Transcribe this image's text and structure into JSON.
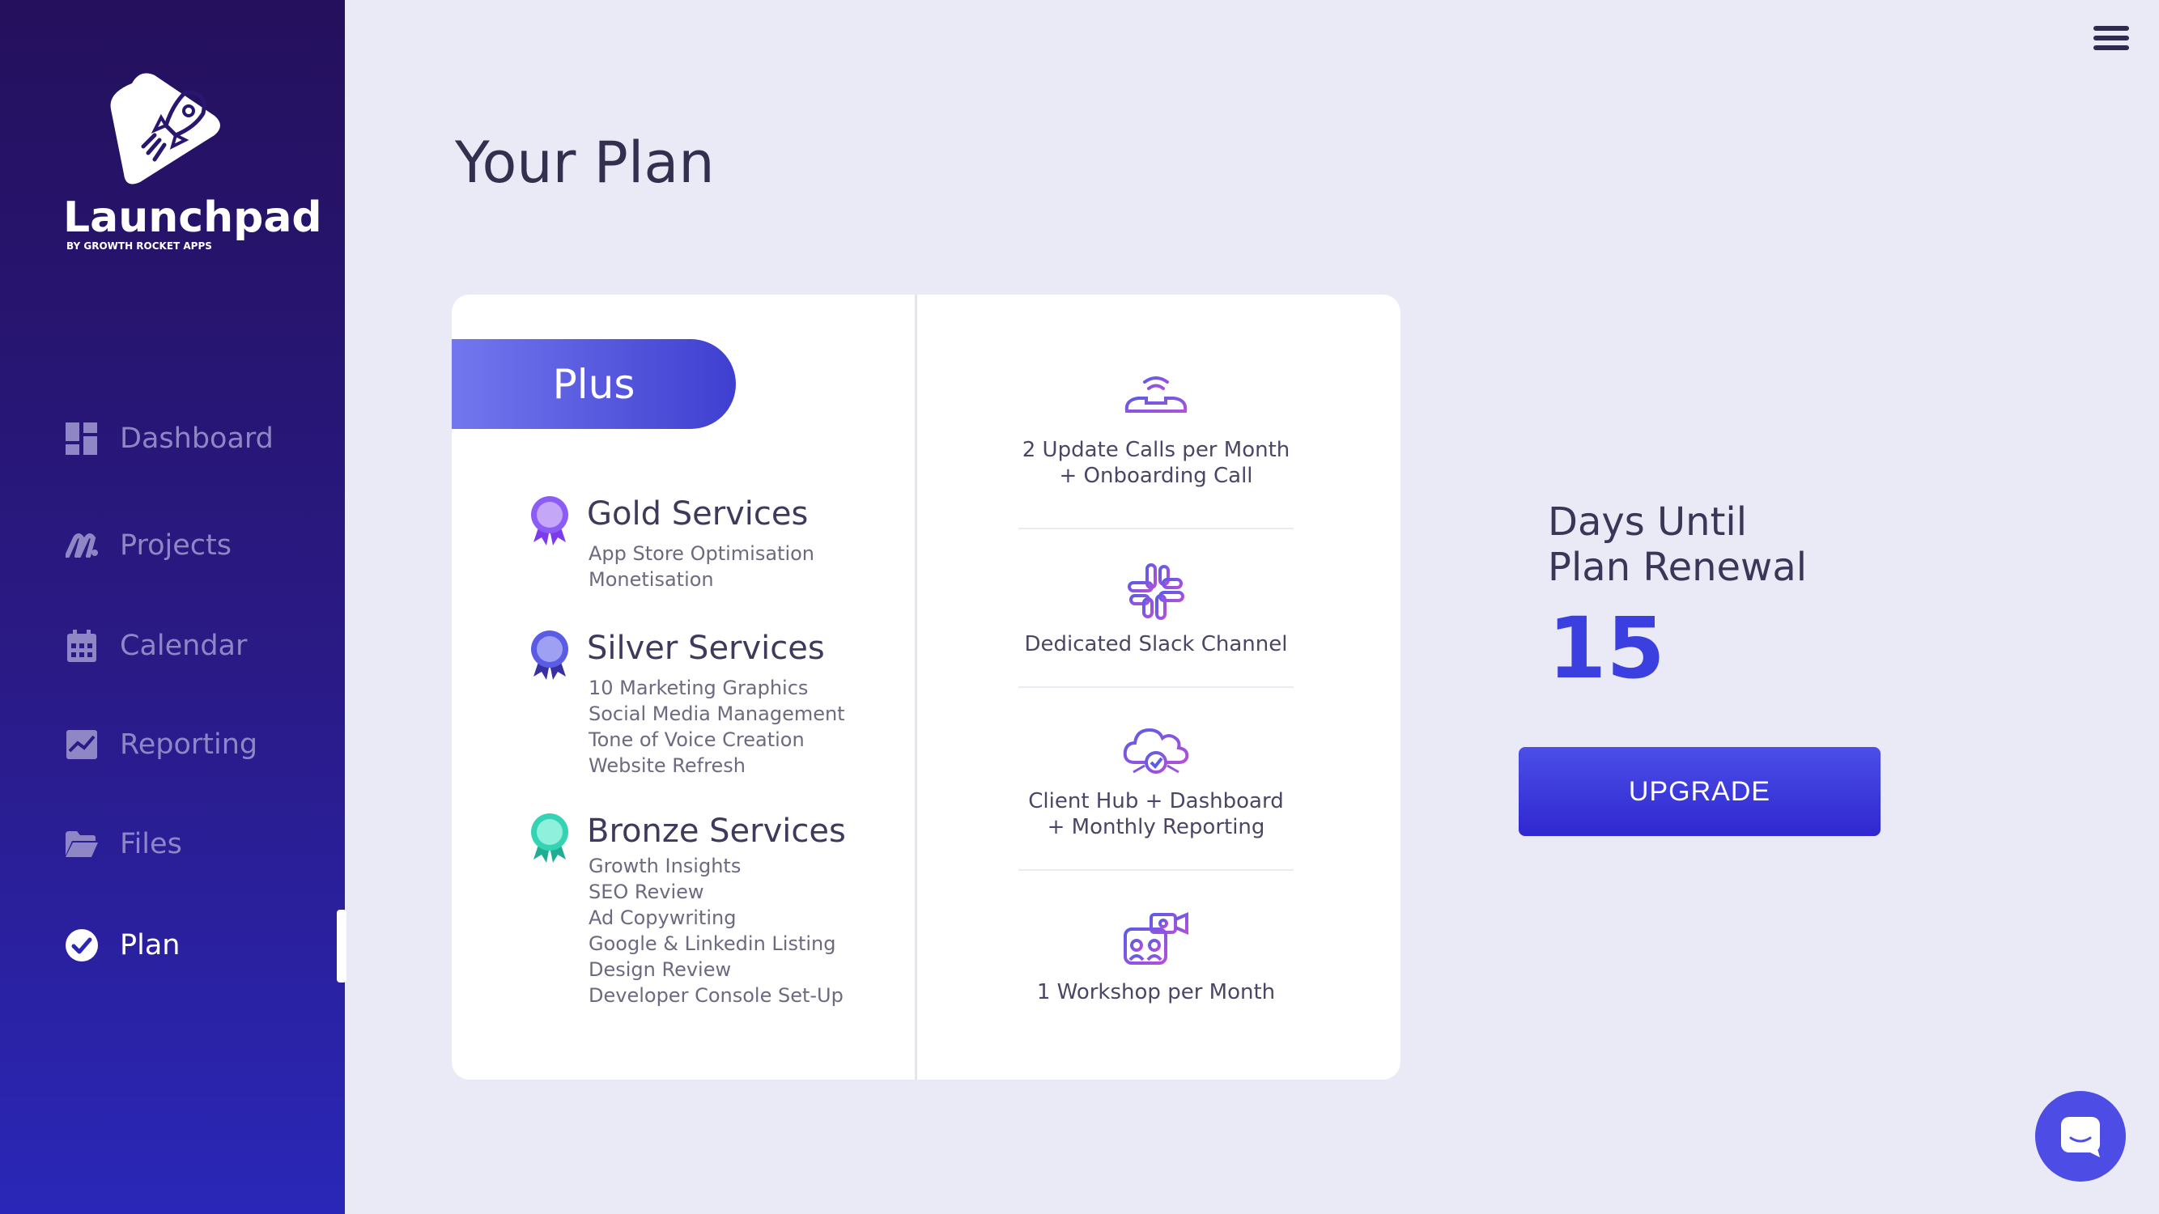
{
  "sidebar": {
    "logo_name": "Launchpad",
    "logo_sub": "BY GROWTH ROCKET APPS",
    "items": [
      {
        "label": "Dashboard",
        "icon": "dashboard-icon"
      },
      {
        "label": "Projects",
        "icon": "projects-icon"
      },
      {
        "label": "Calendar",
        "icon": "calendar-icon"
      },
      {
        "label": "Reporting",
        "icon": "reporting-icon"
      },
      {
        "label": "Files",
        "icon": "folder-icon"
      },
      {
        "label": "Plan",
        "icon": "check-circle-icon",
        "active": true
      }
    ]
  },
  "page": {
    "title": "Your Plan"
  },
  "plan": {
    "name": "Plus",
    "services": [
      {
        "title": "Gold Services",
        "color": "#8b5cf6",
        "items": [
          "App Store Optimisation",
          "Monetisation"
        ]
      },
      {
        "title": "Silver Services",
        "color": "#5b5ce6",
        "items": [
          "10 Marketing Graphics",
          "Social Media Management",
          "Tone of Voice Creation",
          "Website Refresh"
        ]
      },
      {
        "title": "Bronze Services",
        "color": "#34d3b4",
        "items": [
          "Growth Insights",
          "SEO Review",
          "Ad Copywriting",
          "Google & Linkedin Listing",
          "Design Review",
          "Developer Console Set-Up"
        ]
      }
    ],
    "features": [
      {
        "line1": "2 Update Calls per Month",
        "line2": "+ Onboarding Call",
        "icon": "phone-icon"
      },
      {
        "line1": "Dedicated Slack Channel",
        "line2": "",
        "icon": "slack-icon"
      },
      {
        "line1": "Client Hub + Dashboard",
        "line2": "+ Monthly Reporting",
        "icon": "cloud-check-icon"
      },
      {
        "line1": "1 Workshop per Month",
        "line2": "",
        "icon": "video-meeting-icon"
      }
    ]
  },
  "renewal": {
    "label_line1": "Days Until",
    "label_line2": "Plan Renewal",
    "days": "15"
  },
  "actions": {
    "upgrade_label": "UPGRADE"
  },
  "colors": {
    "accent": "#3c3fe0",
    "sidebar_top": "#24105c",
    "sidebar_bottom": "#2a27b8",
    "background": "#eae9f6"
  }
}
